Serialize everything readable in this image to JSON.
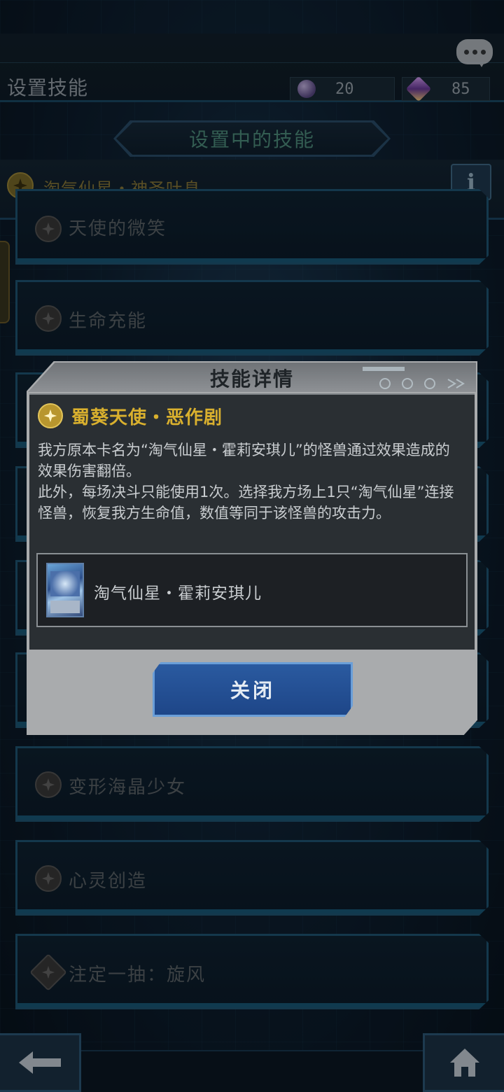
{
  "header": {
    "title": "设置技能",
    "currency_gem": "20",
    "currency_crystal": "85"
  },
  "section": {
    "title": "设置中的技能",
    "current_skill": "淘气仙星・神圣吐息"
  },
  "skills": [
    {
      "label": "天使的微笑"
    },
    {
      "label": "生命充能"
    },
    {
      "label": "变形海晶少女"
    },
    {
      "label": "心灵创造"
    },
    {
      "label": "注定一抽：旋风"
    }
  ],
  "dialog": {
    "title": "技能详情",
    "skill_name": "蜀葵天使・恶作剧",
    "desc_p1": "我方原本卡名为“淘气仙星・霍莉安琪儿”的怪兽通过效果造成的效果伤害翻倍。",
    "desc_p2": "此外，每场决斗只能使用1次。选择我方场上1只“淘气仙星”连接怪兽，恢复我方生命值，数值等同于该怪兽的攻击力。",
    "card_name": "淘气仙星・霍莉安琪儿",
    "close_label": "关闭"
  },
  "icons": {
    "chat": "chat-bubble-icon",
    "gem": "gem-icon",
    "crystal": "crystal-icon",
    "info": "info-icon",
    "star": "star-icon",
    "back": "back-arrow-icon",
    "home": "home-icon"
  },
  "colors": {
    "accent_gold": "#d9b02e",
    "button_blue": "#1e4688"
  }
}
